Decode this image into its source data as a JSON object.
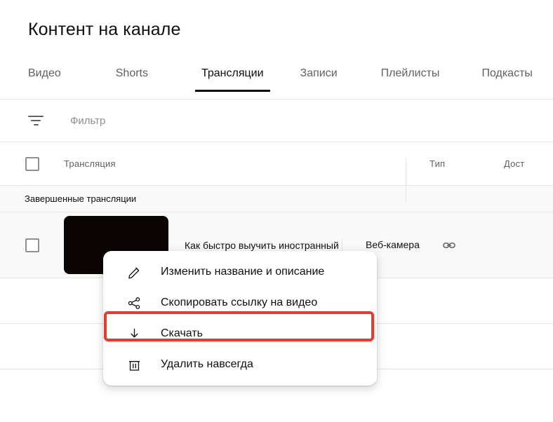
{
  "header": {
    "title": "Контент на канале"
  },
  "tabs": [
    {
      "label": "Видео",
      "active": false
    },
    {
      "label": "Shorts",
      "active": false
    },
    {
      "label": "Трансляции",
      "active": true
    },
    {
      "label": "Записи",
      "active": false
    },
    {
      "label": "Плейлисты",
      "active": false
    },
    {
      "label": "Подкасты",
      "active": false
    }
  ],
  "filter": {
    "icon": "filter-icon",
    "placeholder": "Фильтр",
    "value": ""
  },
  "table": {
    "columns": {
      "title": "Трансляция",
      "type": "Тип",
      "access": "Дост"
    },
    "section_label": "Завершенные трансляции",
    "rows": [
      {
        "title": "Как быстро выучить иностранный ...",
        "type": "Веб-камера",
        "access_icon": "link-icon"
      }
    ]
  },
  "context_menu": {
    "items": [
      {
        "icon": "pencil-icon",
        "label": "Изменить название и описание",
        "highlighted": false
      },
      {
        "icon": "share-icon",
        "label": "Скопировать ссылку на видео",
        "highlighted": false
      },
      {
        "icon": "download-icon",
        "label": "Скачать",
        "highlighted": true
      },
      {
        "icon": "trash-icon",
        "label": "Удалить навсегда",
        "highlighted": false
      }
    ]
  },
  "colors": {
    "highlight_red": "#e8392b",
    "text_primary": "#0f0f0f",
    "text_secondary": "#606060",
    "row_background": "#f9f9f9",
    "border": "#e5e5e5"
  }
}
